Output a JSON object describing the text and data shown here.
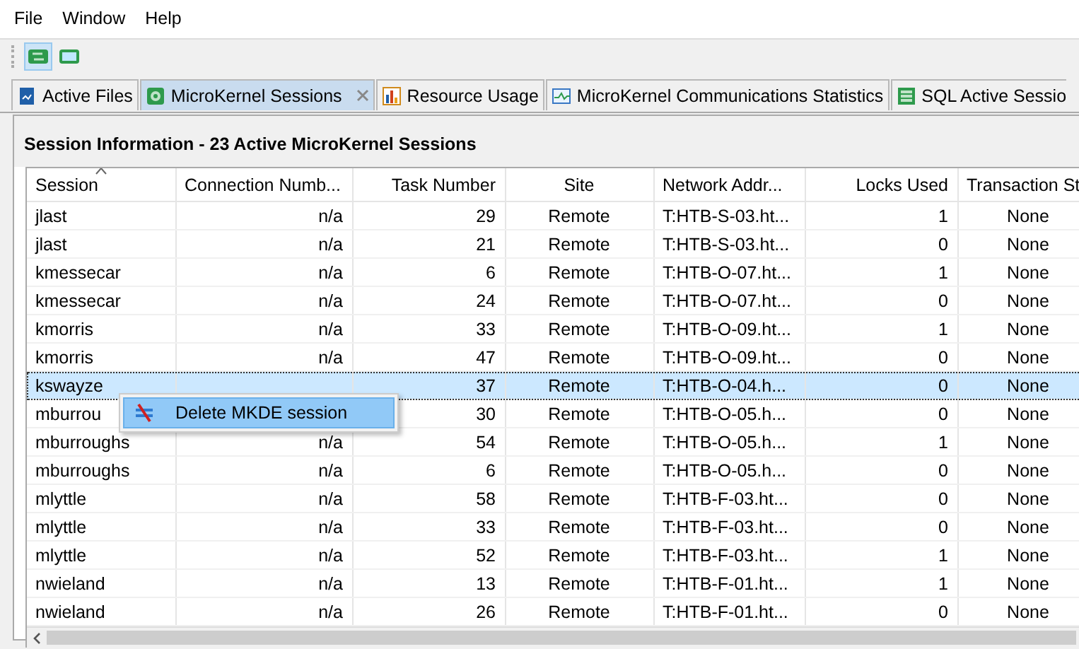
{
  "menu": [
    "File",
    "Window",
    "Help"
  ],
  "toolbar": [
    {
      "kind": "refresh",
      "selected": true
    },
    {
      "kind": "monitor",
      "selected": false
    }
  ],
  "tabs": [
    {
      "label": "Active Files",
      "kind": "files",
      "selected": false,
      "closable": false
    },
    {
      "label": "MicroKernel Sessions",
      "kind": "sessions",
      "selected": true,
      "closable": true
    },
    {
      "label": "Resource Usage",
      "kind": "bars",
      "selected": false,
      "closable": false
    },
    {
      "label": "MicroKernel Communications Statistics",
      "kind": "graph",
      "selected": false,
      "closable": false
    },
    {
      "label": "SQL Active Sessio",
      "kind": "db",
      "selected": false,
      "closable": false
    }
  ],
  "panel_title": "Session Information - 23 Active MicroKernel Sessions",
  "table": {
    "columns": [
      {
        "label": "Session",
        "sorted": true
      },
      {
        "label": "Connection Numb...",
        "sorted": false
      },
      {
        "label": "Task Number",
        "sorted": false
      },
      {
        "label": "Site",
        "sorted": false
      },
      {
        "label": "Network Addr...",
        "sorted": false
      },
      {
        "label": "Locks Used",
        "sorted": false
      },
      {
        "label": "Transaction St",
        "sorted": false
      }
    ],
    "rows": [
      {
        "selected": false,
        "cells": [
          "jlast",
          "n/a",
          "29",
          "Remote",
          "T:HTB-S-03.ht...",
          "1",
          "None"
        ]
      },
      {
        "selected": false,
        "cells": [
          "jlast",
          "n/a",
          "21",
          "Remote",
          "T:HTB-S-03.ht...",
          "0",
          "None"
        ]
      },
      {
        "selected": false,
        "cells": [
          "kmessecar",
          "n/a",
          "6",
          "Remote",
          "T:HTB-O-07.ht...",
          "1",
          "None"
        ]
      },
      {
        "selected": false,
        "cells": [
          "kmessecar",
          "n/a",
          "24",
          "Remote",
          "T:HTB-O-07.ht...",
          "0",
          "None"
        ]
      },
      {
        "selected": false,
        "cells": [
          "kmorris",
          "n/a",
          "33",
          "Remote",
          "T:HTB-O-09.ht...",
          "1",
          "None"
        ]
      },
      {
        "selected": false,
        "cells": [
          "kmorris",
          "n/a",
          "47",
          "Remote",
          "T:HTB-O-09.ht...",
          "0",
          "None"
        ]
      },
      {
        "selected": true,
        "cells": [
          "kswayze",
          null,
          "37",
          "Remote",
          "T:HTB-O-04.h...",
          "0",
          "None"
        ]
      },
      {
        "selected": false,
        "cells": [
          "mburrou",
          null,
          "30",
          "Remote",
          "T:HTB-O-05.h...",
          "0",
          "None"
        ]
      },
      {
        "selected": false,
        "cells": [
          "mburroughs",
          "n/a",
          "54",
          "Remote",
          "T:HTB-O-05.h...",
          "1",
          "None"
        ]
      },
      {
        "selected": false,
        "cells": [
          "mburroughs",
          "n/a",
          "6",
          "Remote",
          "T:HTB-O-05.h...",
          "0",
          "None"
        ]
      },
      {
        "selected": false,
        "cells": [
          "mlyttle",
          "n/a",
          "58",
          "Remote",
          "T:HTB-F-03.ht...",
          "0",
          "None"
        ]
      },
      {
        "selected": false,
        "cells": [
          "mlyttle",
          "n/a",
          "33",
          "Remote",
          "T:HTB-F-03.ht...",
          "0",
          "None"
        ]
      },
      {
        "selected": false,
        "cells": [
          "mlyttle",
          "n/a",
          "52",
          "Remote",
          "T:HTB-F-03.ht...",
          "1",
          "None"
        ]
      },
      {
        "selected": false,
        "cells": [
          "nwieland",
          "n/a",
          "13",
          "Remote",
          "T:HTB-F-01.ht...",
          "1",
          "None"
        ]
      },
      {
        "selected": false,
        "cells": [
          "nwieland",
          "n/a",
          "26",
          "Remote",
          "T:HTB-F-01.ht...",
          "0",
          "None"
        ]
      }
    ]
  },
  "context_menu": {
    "items": [
      {
        "label": "Delete MKDE session",
        "selected": true
      }
    ]
  }
}
